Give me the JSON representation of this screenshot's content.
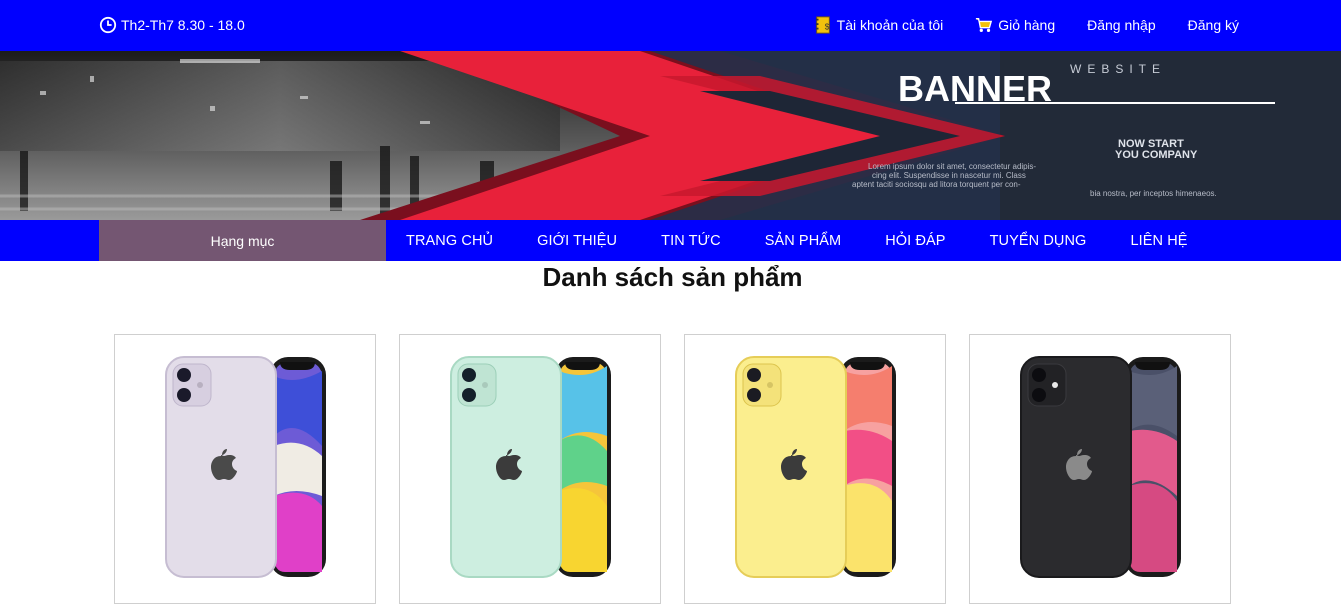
{
  "topbar": {
    "hours": "Th2-Th7 8.30 - 18.0",
    "clock_icon": "clock-icon",
    "account": "Tài khoản của tôi",
    "account_icon": "notebook-icon",
    "cart": "Giỏ hàng",
    "cart_icon": "cart-icon",
    "login": "Đăng nhập",
    "register": "Đăng ký",
    "color": "#0000ff"
  },
  "banner": {
    "small_title": "WEBSITE",
    "title": "BANNER",
    "tagline_1": "NOW START",
    "tagline_2": "YOU COMPANY",
    "body_1": "Lorem ipsum dolor sit amet, consectetur adipis-",
    "body_2": "cing elit. Suspendisse in nascetur mi. Class",
    "body_3": "aptent taciti sociosqu ad litora torquent per con-",
    "body_4": "bia nostra, per inceptos himenaeos."
  },
  "nav": {
    "category": "Hạng mục",
    "category_color": "#745672",
    "items": [
      "TRANG CHỦ",
      "GIỚI THIỆU",
      "TIN TỨC",
      "SẢN PHẨM",
      "HỎI ĐÁP",
      "TUYỂN DỤNG",
      "LIÊN HỆ"
    ]
  },
  "main": {
    "heading": "Danh sách sản phẩm"
  },
  "products": [
    {
      "color": "#e3dde9",
      "screen": "purple"
    },
    {
      "color": "#cdeee0",
      "screen": "green"
    },
    {
      "color": "#fbee8e",
      "screen": "yellow"
    },
    {
      "color": "#2b2b2e",
      "screen": "black"
    }
  ]
}
